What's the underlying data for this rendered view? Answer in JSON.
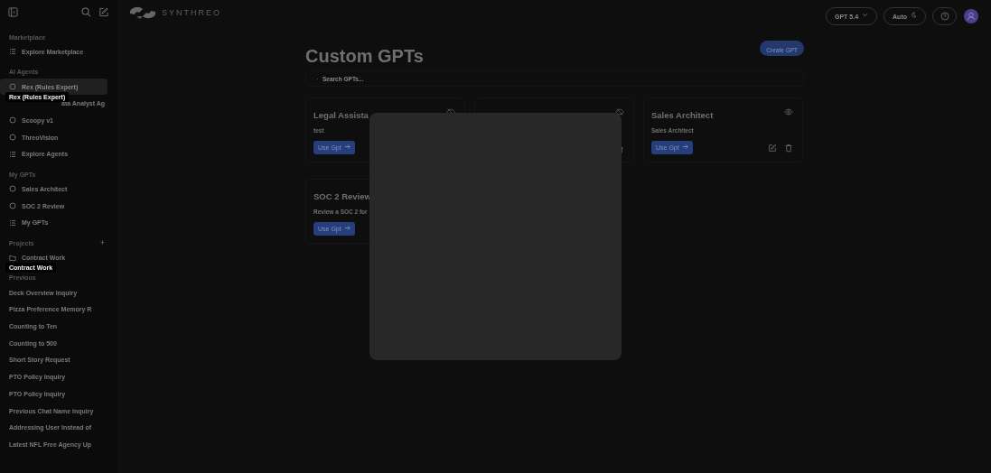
{
  "sidebar": {
    "sections": [
      {
        "label": "Marketplace",
        "items": [
          {
            "kind": "list",
            "label": "Explore Marketplace",
            "selected": false
          }
        ]
      },
      {
        "label": "AI Agents",
        "items": [
          {
            "kind": "agent",
            "label": "Rex (Rules Expert)",
            "selected": true,
            "tooltip": "Rex (Rules Expert)"
          },
          {
            "kind": "partial",
            "label": "ata Analyst Ag",
            "selected": false
          },
          {
            "kind": "agent",
            "label": "Scoopy v1",
            "selected": false
          },
          {
            "kind": "agent",
            "label": "ThreoVision",
            "selected": false
          },
          {
            "kind": "list",
            "label": "Explore Agents",
            "selected": false
          }
        ]
      },
      {
        "label": "My GPTs",
        "items": [
          {
            "kind": "agent",
            "label": "Sales Architect",
            "selected": false
          },
          {
            "kind": "agent",
            "label": "SOC 2 Review",
            "selected": false
          },
          {
            "kind": "list",
            "label": "My GPTs",
            "selected": false
          }
        ]
      },
      {
        "label": "Projects",
        "add": "+",
        "items": [
          {
            "kind": "folder",
            "label": "Contract Work",
            "selected": false,
            "tooltip": "Contract Work"
          }
        ]
      },
      {
        "label": "Previous",
        "items": [
          {
            "kind": "chat",
            "label": "Deck Overview Inquiry",
            "selected": false
          },
          {
            "kind": "chat",
            "label": "Pizza Preference Memory R",
            "selected": false
          },
          {
            "kind": "chat",
            "label": "Counting to Ten",
            "selected": false
          },
          {
            "kind": "chat",
            "label": "Counting to 500",
            "selected": false
          },
          {
            "kind": "chat",
            "label": "Short Story Request",
            "selected": false
          },
          {
            "kind": "chat",
            "label": "PTO Policy Inquiry",
            "selected": false
          },
          {
            "kind": "chat",
            "label": "PTO Policy Inquiry",
            "selected": false
          },
          {
            "kind": "chat",
            "label": "Previous Chat Name Inquiry",
            "selected": false
          },
          {
            "kind": "chat",
            "label": "Addressing User Instead of",
            "selected": false
          },
          {
            "kind": "chat",
            "label": "Latest NFL Free Agency Up",
            "selected": false
          }
        ]
      }
    ]
  },
  "header": {
    "brand": "SYNTHREO",
    "model": "GPT 5.4",
    "theme": "Auto"
  },
  "page": {
    "title": "Custom GPTs",
    "create_button": "Create GPT",
    "search": {
      "placeholder": "Search GPTs..."
    },
    "cards": [
      {
        "title": "Legal Assista",
        "description": "test",
        "button": "Use Gpt",
        "published": false
      },
      {
        "published": false
      },
      {
        "title": "Sales Architect",
        "description": "Sales Architect",
        "button": "Use Gpt",
        "published": true
      },
      {
        "title": "SOC 2 Review",
        "description": "Review a SOC 2 for",
        "button": "Use Gpt"
      }
    ]
  },
  "modal": {
    "open": true
  }
}
